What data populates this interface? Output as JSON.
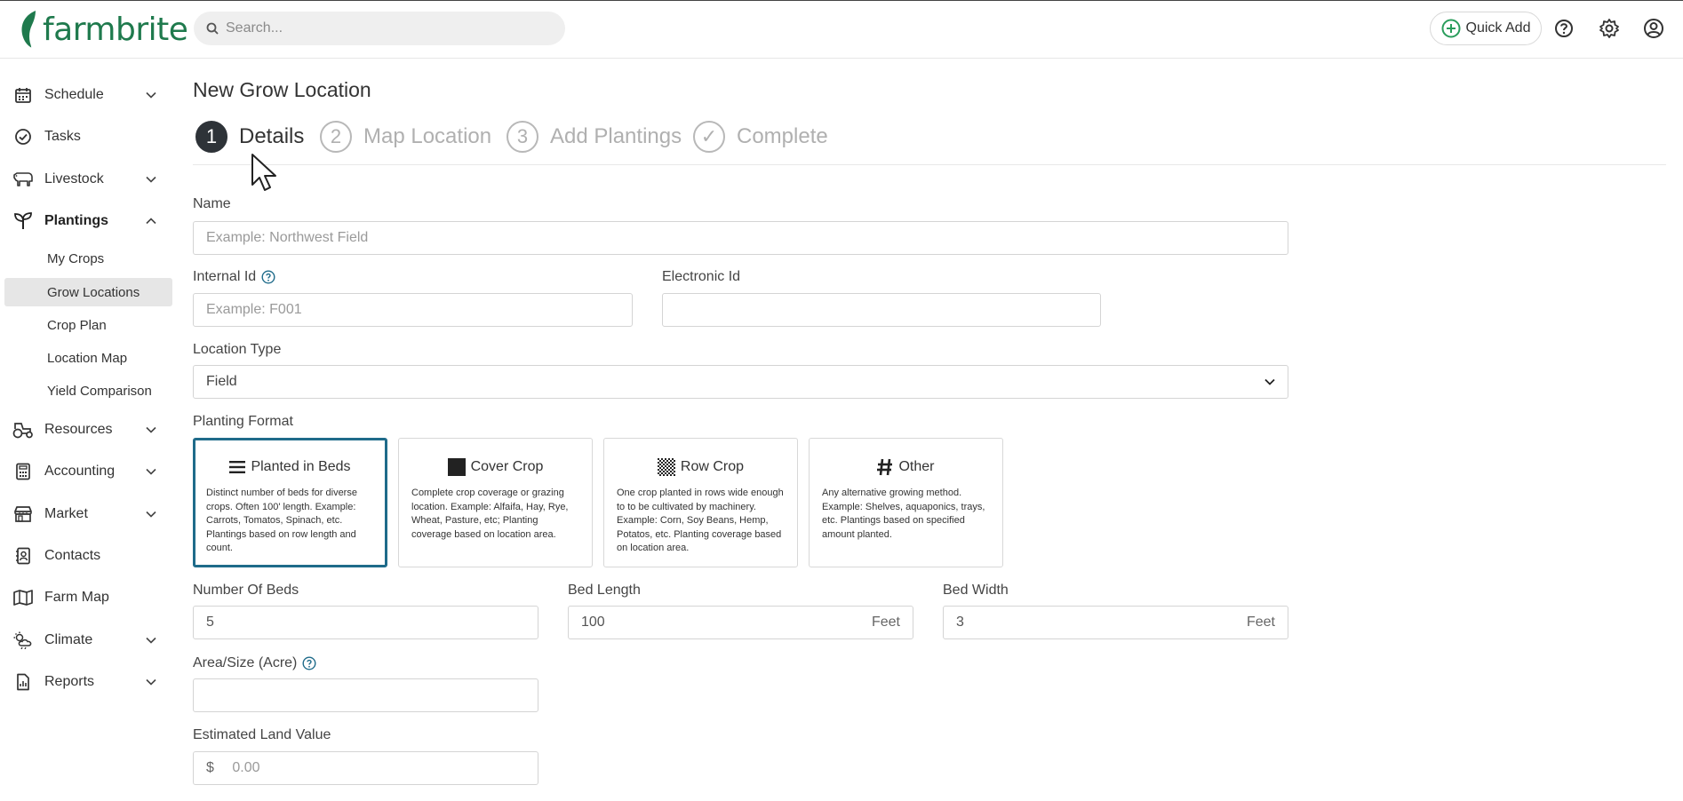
{
  "brand": {
    "name": "farmbrite",
    "color": "#1f7a4d"
  },
  "header": {
    "search_placeholder": "Search...",
    "quick_add_label": "Quick Add",
    "icons": [
      "search-icon",
      "plus-circle-icon",
      "help-icon",
      "gear-icon",
      "user-icon"
    ]
  },
  "sidebar": {
    "items": [
      {
        "label": "Schedule",
        "icon": "calendar-icon",
        "chevron": "down"
      },
      {
        "label": "Tasks",
        "icon": "check-circle-icon"
      },
      {
        "label": "Livestock",
        "icon": "cow-icon",
        "chevron": "down"
      },
      {
        "label": "Plantings",
        "icon": "sprout-icon",
        "chevron": "up",
        "active": true
      },
      {
        "label": "Resources",
        "icon": "tractor-icon",
        "chevron": "down"
      },
      {
        "label": "Accounting",
        "icon": "calculator-icon",
        "chevron": "down"
      },
      {
        "label": "Market",
        "icon": "store-icon",
        "chevron": "down"
      },
      {
        "label": "Contacts",
        "icon": "contact-book-icon"
      },
      {
        "label": "Farm Map",
        "icon": "map-icon"
      },
      {
        "label": "Climate",
        "icon": "cloud-sun-icon",
        "chevron": "down"
      },
      {
        "label": "Reports",
        "icon": "report-icon",
        "chevron": "down"
      }
    ],
    "sub_items": [
      {
        "label": "My Crops"
      },
      {
        "label": "Grow Locations",
        "selected": true
      },
      {
        "label": "Crop Plan"
      },
      {
        "label": "Location Map"
      },
      {
        "label": "Yield Comparison"
      }
    ]
  },
  "page": {
    "title": "New Grow Location",
    "steps": [
      {
        "num": "1",
        "label": "Details",
        "current": true
      },
      {
        "num": "2",
        "label": "Map Location"
      },
      {
        "num": "3",
        "label": "Add Plantings"
      },
      {
        "num": "✓",
        "label": "Complete"
      }
    ]
  },
  "form": {
    "name": {
      "label": "Name",
      "placeholder": "Example: Northwest Field",
      "value": ""
    },
    "internal_id": {
      "label": "Internal Id",
      "placeholder": "Example: F001",
      "value": ""
    },
    "electronic_id": {
      "label": "Electronic Id",
      "value": ""
    },
    "location_type": {
      "label": "Location Type",
      "value": "Field"
    },
    "planting_format": {
      "label": "Planting Format",
      "options": [
        {
          "title": "Planted in Beds",
          "icon": "bars-icon",
          "selected": true,
          "desc": "Distinct number of beds for diverse crops. Often 100' length. Example: Carrots, Tomatos, Spinach, etc. Plantings based on row length and count."
        },
        {
          "title": "Cover Crop",
          "icon": "solid-square-icon",
          "desc": "Complete crop coverage or grazing location. Example: Alfaifa, Hay, Rye, Wheat, Pasture, etc; Planting coverage based on location area."
        },
        {
          "title": "Row Crop",
          "icon": "checkerboard-icon",
          "desc": "One crop planted in rows wide enough to to be cultivated by machinery. Example: Corn, Soy Beans, Hemp, Potatos, etc. Planting coverage based on location area."
        },
        {
          "title": "Other",
          "icon": "hash-icon",
          "desc": "Any alternative growing method. Example: Shelves, aquaponics, trays, etc. Plantings based on specified amount planted."
        }
      ]
    },
    "number_of_beds": {
      "label": "Number Of Beds",
      "value": "5"
    },
    "bed_length": {
      "label": "Bed Length",
      "value": "100",
      "unit": "Feet"
    },
    "bed_width": {
      "label": "Bed Width",
      "value": "3",
      "unit": "Feet"
    },
    "area_size": {
      "label": "Area/Size (Acre)",
      "value": ""
    },
    "land_value": {
      "label": "Estimated Land Value",
      "prefix": "$",
      "placeholder": "0.00",
      "value": ""
    }
  },
  "colors": {
    "accent": "#1f6b8a",
    "step_current": "#2e3338",
    "help_icon": "#1f6b8a",
    "selected_nav_bg": "#e6e6e6"
  }
}
